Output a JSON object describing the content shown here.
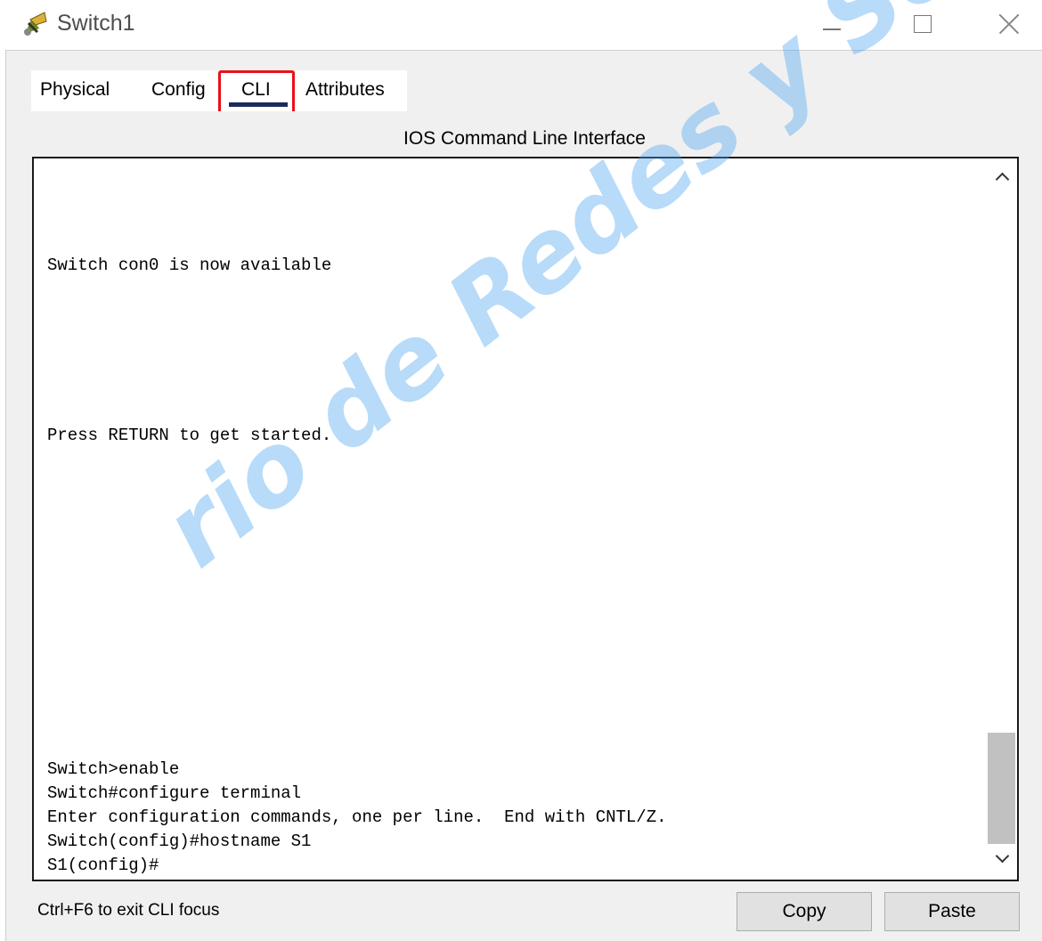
{
  "window": {
    "title": "Switch1",
    "icon": "network-switch-icon",
    "controls": [
      "minimize-icon",
      "maximize-icon",
      "close-icon"
    ]
  },
  "tabs": [
    {
      "label": "Physical",
      "selected": false
    },
    {
      "label": "Config",
      "selected": false
    },
    {
      "label": "CLI",
      "selected": true,
      "highlighted": true
    },
    {
      "label": "Attributes",
      "selected": false
    }
  ],
  "panel": {
    "heading": "IOS Command Line Interface"
  },
  "console": {
    "lines": [
      "Switch con0 is now available",
      "Press RETURN to get started.",
      "Switch>enable",
      "Switch#configure terminal",
      "Enter configuration commands, one per line.  End with CNTL/Z.",
      "Switch(config)#hostname S1",
      "S1(config)#"
    ]
  },
  "footer": {
    "hint": "Ctrl+F6 to exit CLI focus",
    "copy_label": "Copy",
    "paste_label": "Paste"
  },
  "watermark": {
    "text": "rio de Redes y Seguridad -"
  },
  "colors": {
    "highlight_border": "#e8101c",
    "tab_underline": "#1c2c5a",
    "watermark": "#42a0f0",
    "frame_background": "#f0f0f0"
  }
}
